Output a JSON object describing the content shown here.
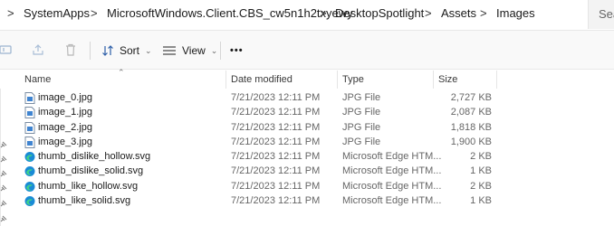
{
  "breadcrumb": {
    "items": [
      "SystemApps",
      "MicrosoftWindows.Client.CBS_cw5n1h2txyewy",
      "DesktopSpotlight",
      "Assets",
      "Images"
    ],
    "separator": ">"
  },
  "search": {
    "placeholder": "Sea"
  },
  "toolbar": {
    "sort_label": "Sort",
    "view_label": "View",
    "more_label": "•••"
  },
  "columns": {
    "name": "Name",
    "date": "Date modified",
    "type": "Type",
    "size": "Size"
  },
  "files": [
    {
      "name": "image_0.jpg",
      "date": "7/21/2023 12:11 PM",
      "type": "JPG File",
      "size": "2,727 KB",
      "icon": "jpg-file-icon"
    },
    {
      "name": "image_1.jpg",
      "date": "7/21/2023 12:11 PM",
      "type": "JPG File",
      "size": "2,087 KB",
      "icon": "jpg-file-icon"
    },
    {
      "name": "image_2.jpg",
      "date": "7/21/2023 12:11 PM",
      "type": "JPG File",
      "size": "1,818 KB",
      "icon": "jpg-file-icon"
    },
    {
      "name": "image_3.jpg",
      "date": "7/21/2023 12:11 PM",
      "type": "JPG File",
      "size": "1,900 KB",
      "icon": "jpg-file-icon"
    },
    {
      "name": "thumb_dislike_hollow.svg",
      "date": "7/21/2023 12:11 PM",
      "type": "Microsoft Edge HTM...",
      "size": "2 KB",
      "icon": "edge-icon"
    },
    {
      "name": "thumb_dislike_solid.svg",
      "date": "7/21/2023 12:11 PM",
      "type": "Microsoft Edge HTM...",
      "size": "1 KB",
      "icon": "edge-icon"
    },
    {
      "name": "thumb_like_hollow.svg",
      "date": "7/21/2023 12:11 PM",
      "type": "Microsoft Edge HTM...",
      "size": "2 KB",
      "icon": "edge-icon"
    },
    {
      "name": "thumb_like_solid.svg",
      "date": "7/21/2023 12:11 PM",
      "type": "Microsoft Edge HTM...",
      "size": "1 KB",
      "icon": "edge-icon"
    }
  ]
}
